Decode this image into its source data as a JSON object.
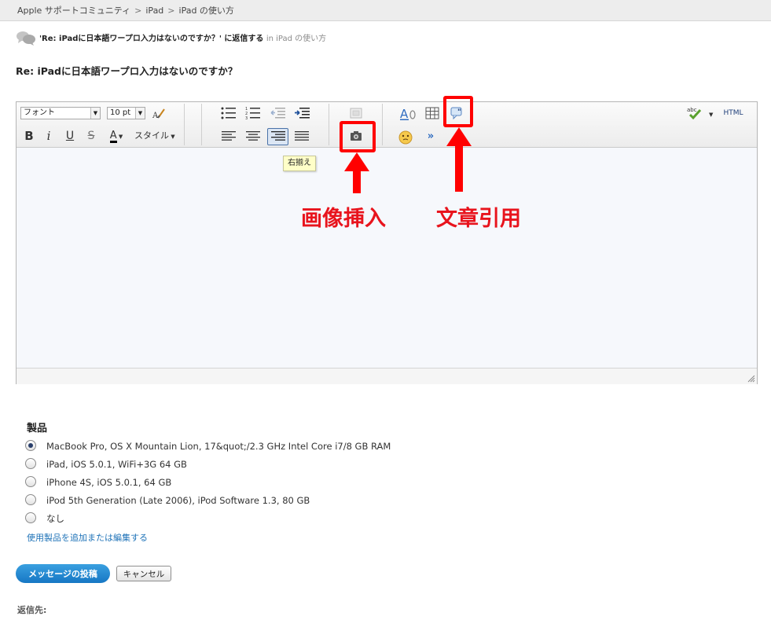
{
  "breadcrumb": [
    "Apple サポートコミュニティ",
    "iPad",
    "iPad の使い方"
  ],
  "breadcrumb_sep": ">",
  "reply_header": {
    "title": "'Re: iPadに日本語ワープロ入力はないのですか？' に返信する",
    "location": "in iPad の使い方"
  },
  "subject": "Re: iPadに日本語ワープロ入力はないのですか？",
  "toolbar": {
    "font_family": "フォント",
    "font_size": "10 pt",
    "style_label": "スタイル",
    "html_label": "HTML"
  },
  "tooltip": "右揃え",
  "annotations": {
    "insert_image": "画像挿入",
    "quote": "文章引用"
  },
  "products": {
    "heading": "製品",
    "items": [
      "MacBook Pro, OS X Mountain Lion, 17&quot;/2.3 GHz Intel Core i7/8 GB RAM",
      "iPad, iOS 5.0.1, WiFi+3G 64 GB",
      "iPhone 4S, iOS 5.0.1, 64 GB",
      "iPod 5th Generation (Late 2006), iPod Software 1.3, 80 GB",
      "なし"
    ],
    "selected_index": 0,
    "edit_link": "使用製品を追加または編集する"
  },
  "buttons": {
    "post": "メッセージの投稿",
    "cancel": "キャンセル"
  },
  "reply_to": "返信先:",
  "colors": {
    "annotation_red": "#ff0000",
    "link_blue": "#1f73b8",
    "post_button": "#1677c4"
  }
}
